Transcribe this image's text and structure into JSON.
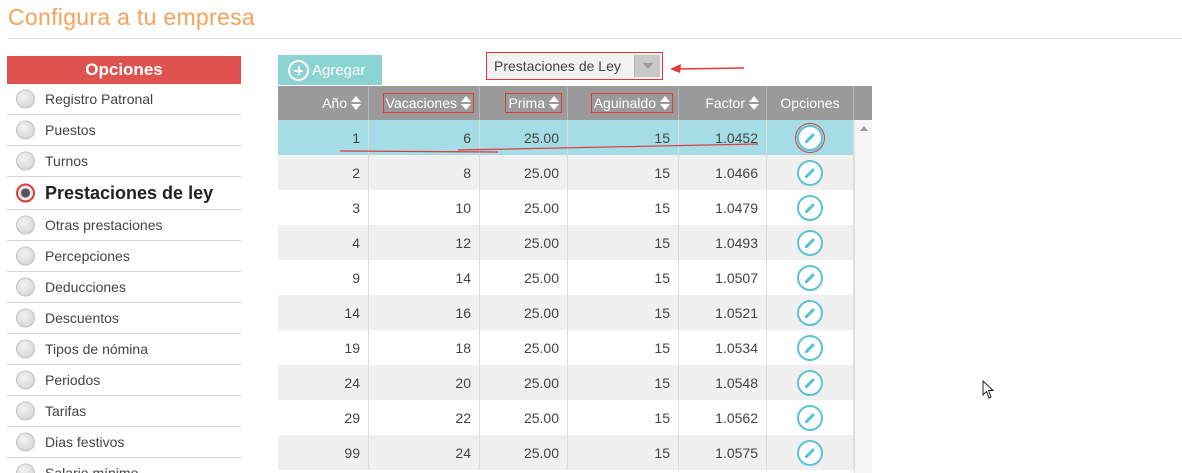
{
  "page": {
    "title": "Configura a tu empresa"
  },
  "sidebar": {
    "header": "Opciones",
    "items": [
      {
        "label": "Registro Patronal",
        "active": false
      },
      {
        "label": "Puestos",
        "active": false
      },
      {
        "label": "Turnos",
        "active": false
      },
      {
        "label": "Prestaciones de ley",
        "active": true
      },
      {
        "label": "Otras prestaciones",
        "active": false
      },
      {
        "label": "Percepciones",
        "active": false
      },
      {
        "label": "Deducciones",
        "active": false
      },
      {
        "label": "Descuentos",
        "active": false
      },
      {
        "label": "Tipos de nómina",
        "active": false
      },
      {
        "label": "Periodos",
        "active": false
      },
      {
        "label": "Tarifas",
        "active": false
      },
      {
        "label": "Dias festivos",
        "active": false
      },
      {
        "label": "Salario mínimo",
        "active": false
      }
    ]
  },
  "toolbar": {
    "add_label": "Agregar"
  },
  "filter": {
    "selected": "Prestaciones de Ley"
  },
  "table": {
    "columns": [
      "Año",
      "Vacaciones",
      "Prima",
      "Aguinaldo",
      "Factor",
      "Opciones"
    ],
    "rows": [
      [
        "1",
        "6",
        "25.00",
        "15",
        "1.0452"
      ],
      [
        "2",
        "8",
        "25.00",
        "15",
        "1.0466"
      ],
      [
        "3",
        "10",
        "25.00",
        "15",
        "1.0479"
      ],
      [
        "4",
        "12",
        "25.00",
        "15",
        "1.0493"
      ],
      [
        "9",
        "14",
        "25.00",
        "15",
        "1.0507"
      ],
      [
        "14",
        "16",
        "25.00",
        "15",
        "1.0521"
      ],
      [
        "19",
        "18",
        "25.00",
        "15",
        "1.0534"
      ],
      [
        "24",
        "20",
        "25.00",
        "15",
        "1.0548"
      ],
      [
        "29",
        "22",
        "25.00",
        "15",
        "1.0562"
      ],
      [
        "99",
        "24",
        "25.00",
        "15",
        "1.0575"
      ]
    ]
  },
  "colors": {
    "title": "#f5a35a",
    "sidebar_header": "#de5350",
    "add_button": "#8cd3d3",
    "selected_row": "#a4dde6",
    "annotation": "#e03a3a",
    "edit_icon": "#5bc3d4"
  }
}
